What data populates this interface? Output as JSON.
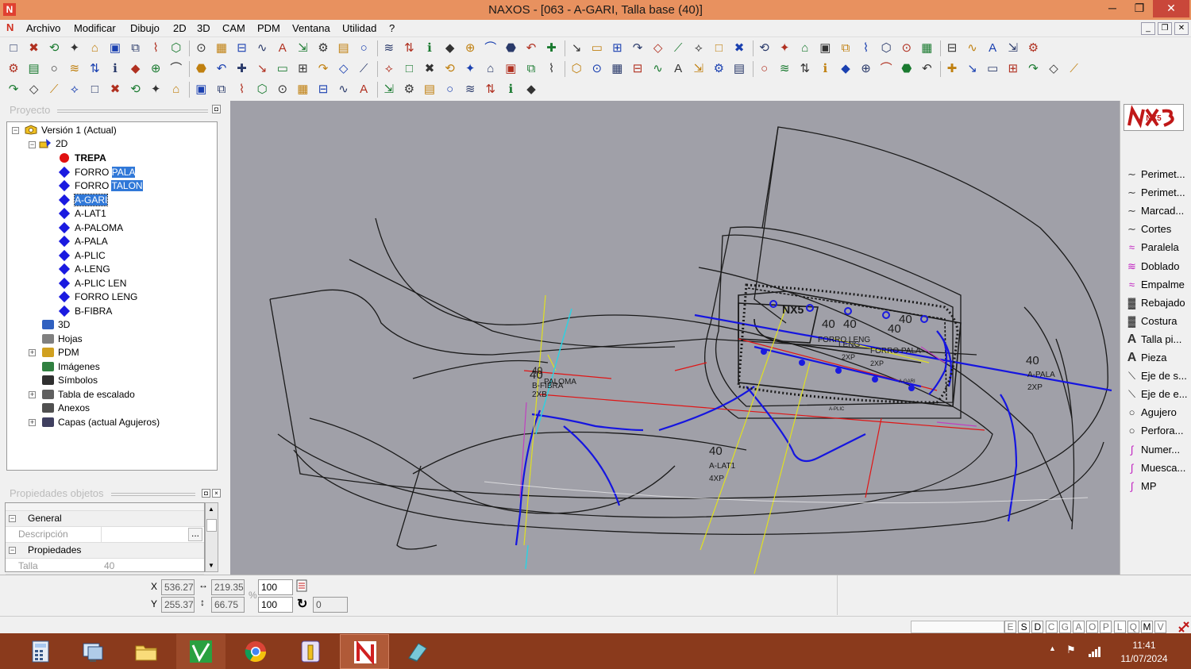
{
  "window": {
    "title": "NAXOS - [063 - A-GARI, Talla base (40)]",
    "min_glyph": "─",
    "max_glyph": "❐",
    "close_glyph": "✕"
  },
  "menubar": {
    "items": [
      "Archivo",
      "Modificar",
      "Dibujo",
      "2D",
      "3D",
      "CAM",
      "PDM",
      "Ventana",
      "Utilidad",
      "?"
    ],
    "mdi": [
      "_",
      "❐",
      "✕"
    ]
  },
  "project": {
    "header": "Proyecto",
    "root": "Versión 1 (Actual)",
    "node_2d": "2D",
    "pieces": [
      "TREPA",
      "FORRO PALA",
      "FORRO TALON",
      "A-GARI",
      "A-LAT1",
      "A-PALOMA",
      "A-PALA",
      "A-PLIC",
      "A-LENG",
      "A-PLIC LEN",
      "FORRO LENG",
      "B-FIBRA"
    ],
    "selected_piece": "A-GARI",
    "others": [
      "3D",
      "Hojas",
      "PDM",
      "Imágenes",
      "Símbolos",
      "Tabla de escalado",
      "Anexos",
      "Capas (actual Agujeros)"
    ]
  },
  "properties": {
    "header": "Propiedades objetos",
    "group_general": "General",
    "desc_label": "Descripción",
    "desc_value": "",
    "desc_btn": "...",
    "group_props": "Propiedades",
    "talla_label": "Talla",
    "talla_value": "40"
  },
  "canvas": {
    "labels": {
      "size40": "40",
      "forro_leng": "FORRO LENG",
      "forro_pala": "FORRO PALA",
      "two_xp": "2XP",
      "four_xp": "4XP",
      "a_lat1": "A-LAT1",
      "a_pala": "A-PALA",
      "paloma": "PALOMA",
      "b_fibra": "B-FIBRA",
      "two_x_b": "2XB",
      "a_leng": "A-LENG",
      "leng": "LENG",
      "a_gari": "A-GARI",
      "a_plic": "A-PLIC",
      "logo": "NX5"
    }
  },
  "tools": {
    "logo": "NX5",
    "items": [
      {
        "label": "Perimet...",
        "icon": "curve-icon"
      },
      {
        "label": "Perimet...",
        "icon": "curve-icon"
      },
      {
        "label": "Marcad...",
        "icon": "curve-icon"
      },
      {
        "label": "Cortes",
        "icon": "curve-icon"
      },
      {
        "label": "Paralela",
        "icon": "parallel-icon"
      },
      {
        "label": "Doblado",
        "icon": "fold-icon"
      },
      {
        "label": "Empalme",
        "icon": "join-icon"
      },
      {
        "label": "Rebajado",
        "icon": "skive-icon"
      },
      {
        "label": "Costura",
        "icon": "seam-icon"
      },
      {
        "label": "Talla pi...",
        "icon": "text-icon"
      },
      {
        "label": "Pieza",
        "icon": "text-icon"
      },
      {
        "label": "Eje de s...",
        "icon": "axis-icon"
      },
      {
        "label": "Eje de e...",
        "icon": "axis-icon"
      },
      {
        "label": "Agujero",
        "icon": "circle-icon"
      },
      {
        "label": "Perfora...",
        "icon": "circle-icon"
      },
      {
        "label": "Numer...",
        "icon": "number-icon"
      },
      {
        "label": "Muesca...",
        "icon": "notch-icon"
      },
      {
        "label": "MP",
        "icon": "mp-icon"
      }
    ]
  },
  "coords": {
    "x_label": "X",
    "y_label": "Y",
    "x": "536.27",
    "y": "255.37",
    "w": "219.35",
    "h": "66.75",
    "scale_x": "100",
    "scale_y": "100",
    "pct": "%",
    "rotation": "0"
  },
  "status": {
    "letters": [
      "E",
      "S",
      "D",
      "C",
      "G",
      "A",
      "O",
      "P",
      "L",
      "Q",
      "M",
      "V"
    ]
  },
  "taskbar": {
    "time": "11:41",
    "date": "11/07/2024",
    "tray_arrow": "▲",
    "tray_flag": "⚑",
    "tray_signal": "📶"
  },
  "colors": {
    "titlebar": "#e8915f",
    "selection": "#3078d8",
    "canvas": "#a0a0a8",
    "taskbar": "#8a3a1c",
    "piece_blue": "#1a1ae0"
  }
}
